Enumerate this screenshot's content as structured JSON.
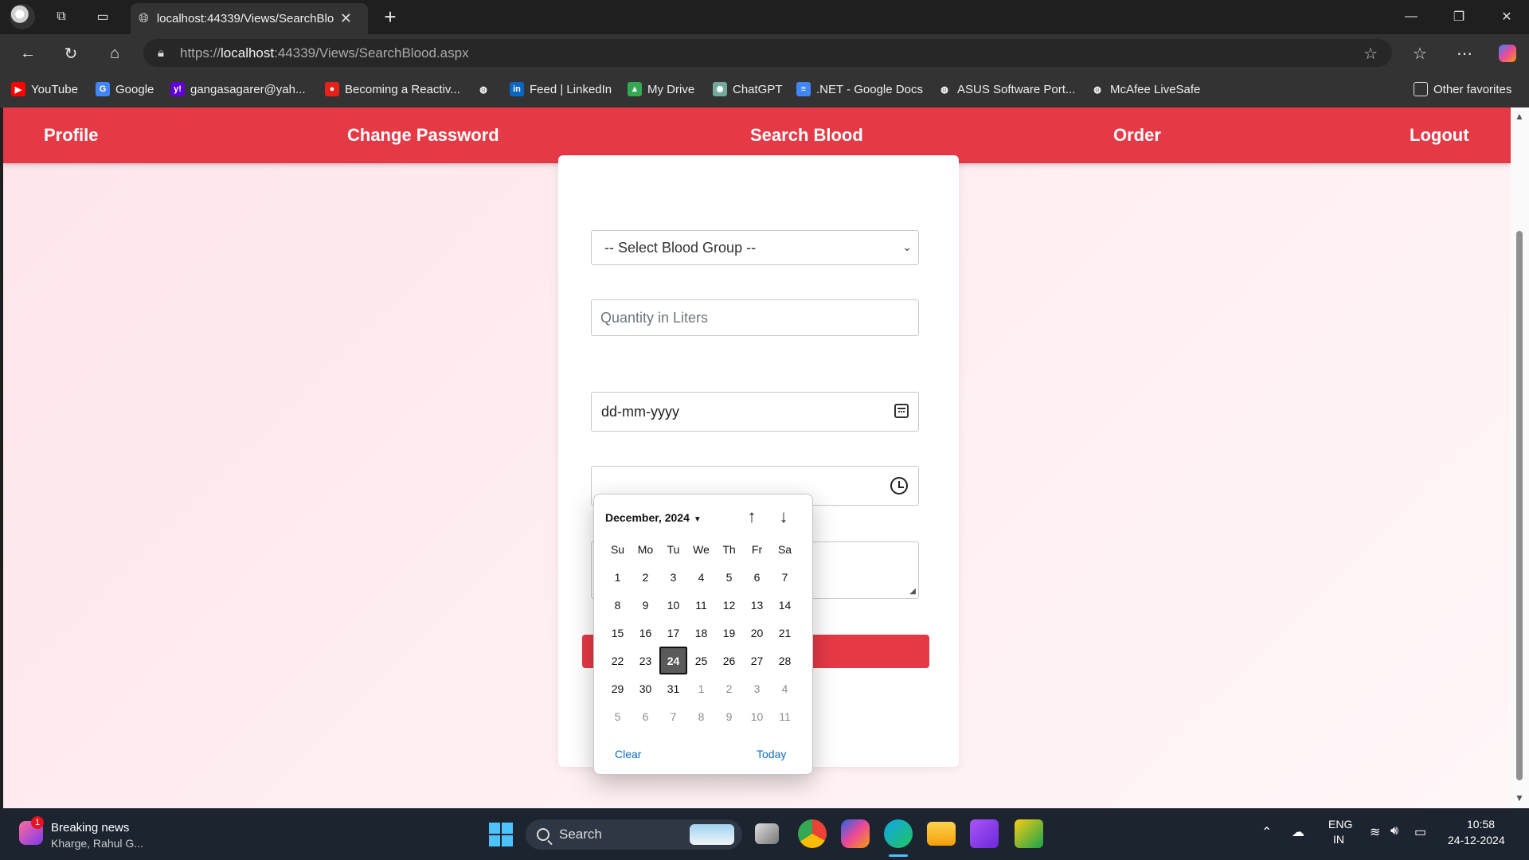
{
  "browser": {
    "tab_title": "localhost:44339/Views/SearchBlo",
    "url_prefix": "https://",
    "url_host": "localhost",
    "url_rest": ":44339/Views/SearchBlood.aspx",
    "favorites": [
      {
        "label": "YouTube",
        "icon": "youtube-icon",
        "color": "#ff0000"
      },
      {
        "label": "Google",
        "icon": "google-icon",
        "color": "#4285f4"
      },
      {
        "label": "gangasagarer@yah...",
        "icon": "yahoo-icon",
        "color": "#6001d2"
      },
      {
        "label": "Becoming a Reactiv...",
        "icon": "site-icon",
        "color": "#e62117"
      },
      {
        "label": "",
        "icon": "globe-icon",
        "color": "#333333"
      },
      {
        "label": "Feed | LinkedIn",
        "icon": "linkedin-icon",
        "color": "#0a66c2"
      },
      {
        "label": "My Drive",
        "icon": "drive-icon",
        "color": "#34a853"
      },
      {
        "label": "ChatGPT",
        "icon": "chatgpt-icon",
        "color": "#74aa9c"
      },
      {
        "label": ".NET - Google Docs",
        "icon": "docs-icon",
        "color": "#4285f4"
      },
      {
        "label": "ASUS Software Port...",
        "icon": "globe-icon",
        "color": "#333333"
      },
      {
        "label": "McAfee LiveSafe",
        "icon": "globe-icon",
        "color": "#333333"
      }
    ],
    "other_favorites": "Other favorites"
  },
  "nav": {
    "profile": "Profile",
    "change_password": "Change Password",
    "search_blood": "Search Blood",
    "order": "Order",
    "logout": "Logout",
    "color": "#e63946"
  },
  "form": {
    "blood_group_selected": "-- Select Blood Group --",
    "quantity_placeholder": "Quantity in Liters",
    "date_placeholder": "dd-mm-yyyy"
  },
  "datepicker": {
    "month_label": "December, 2024",
    "weekdays": [
      "Su",
      "Mo",
      "Tu",
      "We",
      "Th",
      "Fr",
      "Sa"
    ],
    "weeks": [
      [
        "1",
        "2",
        "3",
        "4",
        "5",
        "6",
        "7"
      ],
      [
        "8",
        "9",
        "10",
        "11",
        "12",
        "13",
        "14"
      ],
      [
        "15",
        "16",
        "17",
        "18",
        "19",
        "20",
        "21"
      ],
      [
        "22",
        "23",
        "24",
        "25",
        "26",
        "27",
        "28"
      ],
      [
        "29",
        "30",
        "31",
        "1",
        "2",
        "3",
        "4"
      ],
      [
        "5",
        "6",
        "7",
        "8",
        "9",
        "10",
        "11"
      ]
    ],
    "selected_day": "24",
    "clear_label": "Clear",
    "today_label": "Today"
  },
  "taskbar": {
    "news_badge": "1",
    "news_title": "Breaking news",
    "news_subtitle": "Kharge, Rahul G...",
    "search_label": "Search",
    "lang_top": "ENG",
    "lang_bottom": "IN",
    "time": "10:58",
    "date": "24-12-2024"
  }
}
